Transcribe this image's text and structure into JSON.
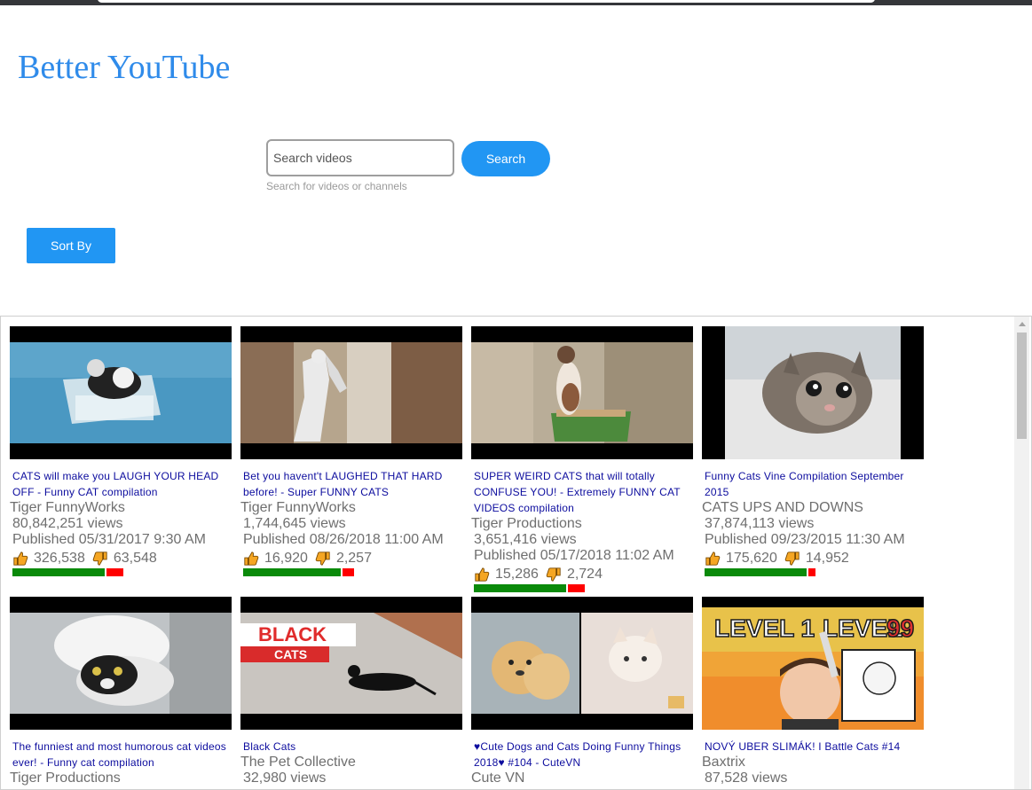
{
  "app": {
    "title": "Better YouTube"
  },
  "search": {
    "placeholder": "Search videos",
    "value": "",
    "button_label": "Search",
    "helper_text": "Search for videos or channels"
  },
  "sort": {
    "label": "Sort By"
  },
  "colors": {
    "accent": "#2196f3",
    "title_color": "#2f8bea",
    "link_color": "#0c0c9e",
    "like_bar": "#0a8a0a",
    "dislike_bar": "#ff0000"
  },
  "videos": [
    {
      "title": "CATS will make you LAUGH YOUR HEAD OFF - Funny CAT compilation",
      "channel": "Tiger FunnyWorks",
      "views": "80,842,251 views",
      "published": "Published 05/31/2017 9:30 AM",
      "likes": "326,538",
      "dislikes": "63,548",
      "like_ratio": 0.837
    },
    {
      "title": "Bet you havent't LAUGHED THAT HARD before! - Super FUNNY CATS",
      "channel": "Tiger FunnyWorks",
      "views": "1,744,645 views",
      "published": "Published 08/26/2018 11:00 AM",
      "likes": "16,920",
      "dislikes": "2,257",
      "like_ratio": 0.882
    },
    {
      "title": "SUPER WEIRD CATS that will totally CONFUSE YOU! - Extremely FUNNY CAT VIDEOS compilation",
      "channel": "Tiger Productions",
      "views": "3,651,416 views",
      "published": "Published 05/17/2018 11:02 AM",
      "likes": "15,286",
      "dislikes": "2,724",
      "like_ratio": 0.849
    },
    {
      "title": "Funny Cats Vine Compilation September 2015",
      "channel": "CATS UPS AND DOWNS",
      "views": "37,874,113 views",
      "published": "Published 09/23/2015 11:30 AM",
      "likes": "175,620",
      "dislikes": "14,952",
      "like_ratio": 0.922
    },
    {
      "title": "The funniest and most humorous cat videos ever! - Funny cat compilation",
      "channel": "Tiger Productions",
      "views": "",
      "published": "",
      "likes": "",
      "dislikes": "",
      "like_ratio": null
    },
    {
      "title": "Black Cats",
      "channel": "The Pet Collective",
      "views": "32,980 views",
      "published": "",
      "likes": "",
      "dislikes": "",
      "like_ratio": null
    },
    {
      "title": "♥Cute Dogs and Cats Doing Funny Things 2018♥ #104 - CuteVN",
      "channel": "Cute VN",
      "views": "",
      "published": "",
      "likes": "",
      "dislikes": "",
      "like_ratio": null
    },
    {
      "title": "NOVÝ UBER SLIMÁK! I Battle Cats #14",
      "channel": "Baxtrix",
      "views": "87,528 views",
      "published": "",
      "likes": "",
      "dislikes": "",
      "like_ratio": null
    }
  ],
  "thumbnail_text": {
    "black_cats_line1": "BLACK",
    "black_cats_line2": "CATS",
    "level_left": "LEVEL 1",
    "level_right": "LEVEL",
    "level_num": "99"
  }
}
